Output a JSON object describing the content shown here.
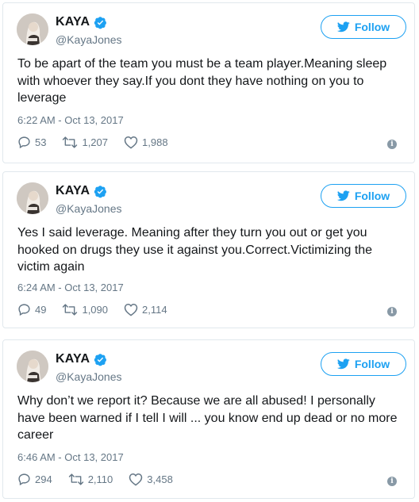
{
  "colors": {
    "brand": "#1da1f2",
    "text": "#14171a",
    "muted": "#657786",
    "border": "#e1e8ed"
  },
  "follow_label": "Follow",
  "tweets": [
    {
      "name": "KAYA",
      "handle": "@KayaJones",
      "text": "To be apart of the team you must be a team player.Meaning sleep with whoever they say.If you dont they have nothing on you to leverage",
      "time": "6:22 AM - Oct 13, 2017",
      "replies": "53",
      "retweets": "1,207",
      "likes": "1,988"
    },
    {
      "name": "KAYA",
      "handle": "@KayaJones",
      "text": "Yes I said leverage. Meaning after they turn you out or get you hooked on drugs they use it against you.Correct.Victimizing the victim again",
      "time": "6:24 AM - Oct 13, 2017",
      "replies": "49",
      "retweets": "1,090",
      "likes": "2,114"
    },
    {
      "name": "KAYA",
      "handle": "@KayaJones",
      "text": "Why don’t we report it? Because we are all abused! I personally have been warned if I tell I will ... you know end up dead or no more career",
      "time": "6:46 AM - Oct 13, 2017",
      "replies": "294",
      "retweets": "2,110",
      "likes": "3,458"
    }
  ]
}
